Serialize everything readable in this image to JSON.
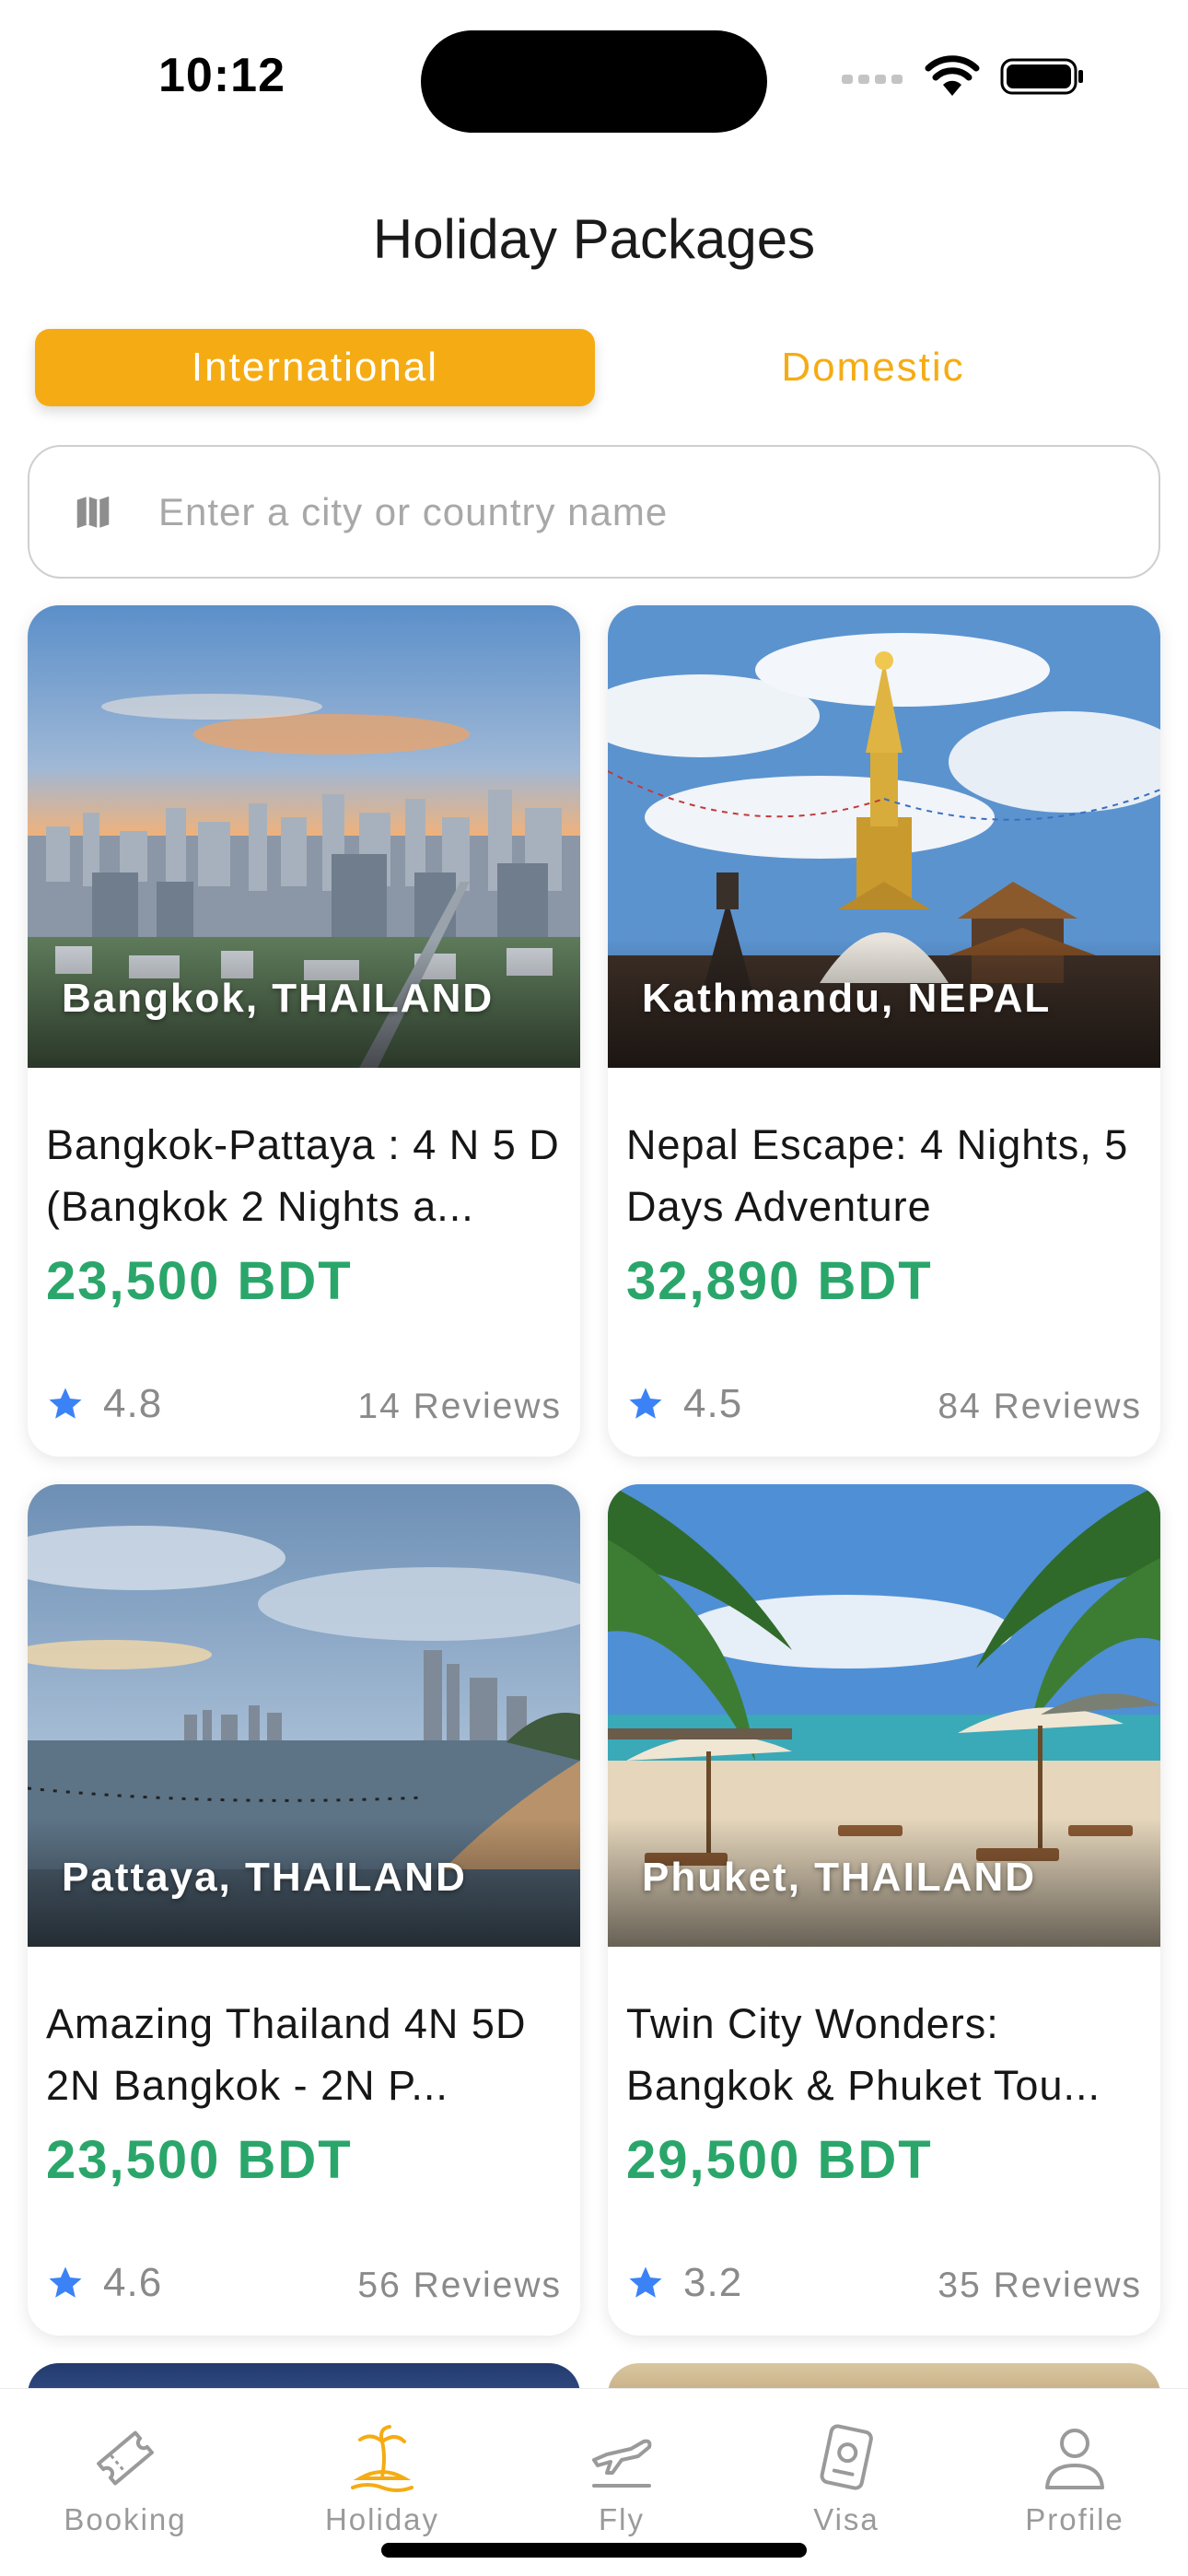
{
  "status": {
    "time": "10:12"
  },
  "header": {
    "title": "Holiday Packages"
  },
  "segments": {
    "international": "International",
    "domestic": "Domestic",
    "active": "International"
  },
  "search": {
    "placeholder": "Enter a city or country name",
    "value": "",
    "icon": "map-icon"
  },
  "packages": [
    {
      "location": "Bangkok, THAILAND",
      "title": "Bangkok-Pattaya : 4 N 5 D  (Bangkok 2 Nights a...",
      "price": "23,500 BDT",
      "rating": "4.8",
      "reviews": "14 Reviews",
      "scene": "city"
    },
    {
      "location": "Kathmandu, NEPAL",
      "title": "Nepal Escape: 4 Nights, 5 Days Adventure",
      "price": "32,890 BDT",
      "rating": "4.5",
      "reviews": "84 Reviews",
      "scene": "temple"
    },
    {
      "location": "Pattaya, THAILAND",
      "title": "Amazing Thailand 4N 5D  2N Bangkok - 2N P...",
      "price": "23,500 BDT",
      "rating": "4.6",
      "reviews": "56 Reviews",
      "scene": "beach-city"
    },
    {
      "location": "Phuket, THAILAND",
      "title": "Twin City Wonders: Bangkok & Phuket Tou...",
      "price": "29,500 BDT",
      "rating": "3.2",
      "reviews": "35 Reviews",
      "scene": "beach-palms"
    }
  ],
  "tabbar": {
    "items": [
      {
        "label": "Booking",
        "icon": "ticket-icon"
      },
      {
        "label": "Holiday",
        "icon": "island-icon"
      },
      {
        "label": "Fly",
        "icon": "plane-icon"
      },
      {
        "label": "Visa",
        "icon": "passport-icon"
      },
      {
        "label": "Profile",
        "icon": "person-icon"
      }
    ],
    "active": "Holiday"
  },
  "colors": {
    "accent": "#f5ac14",
    "price": "#2aa66b",
    "star": "#3b82f6"
  }
}
